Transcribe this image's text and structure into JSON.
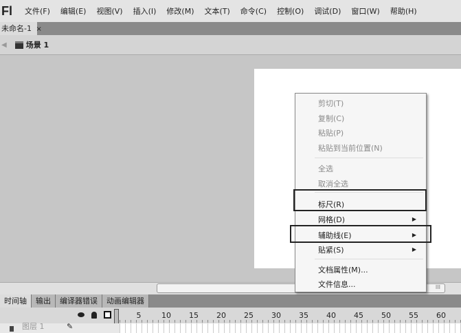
{
  "app": {
    "logo": "Fl"
  },
  "menubar": [
    "文件(F)",
    "编辑(E)",
    "视图(V)",
    "插入(I)",
    "修改(M)",
    "文本(T)",
    "命令(C)",
    "控制(O)",
    "调试(D)",
    "窗口(W)",
    "帮助(H)"
  ],
  "document_tab": {
    "title": "未命名-1",
    "close": "×"
  },
  "scene": {
    "label": "场景 1"
  },
  "context_menu": {
    "items": [
      {
        "label": "剪切(T)",
        "enabled": false
      },
      {
        "label": "复制(C)",
        "enabled": false
      },
      {
        "label": "粘贴(P)",
        "enabled": false
      },
      {
        "label": "粘贴到当前位置(N)",
        "enabled": false
      },
      {
        "label": "全选",
        "enabled": false
      },
      {
        "label": "取消全选",
        "enabled": false
      },
      {
        "label": "标尺(R)",
        "enabled": true,
        "highlighted": true
      },
      {
        "label": "网格(D)",
        "enabled": true,
        "submenu": true
      },
      {
        "label": "辅助线(E)",
        "enabled": true,
        "submenu": true,
        "highlighted": true
      },
      {
        "label": "贴紧(S)",
        "enabled": true,
        "submenu": true
      },
      {
        "label": "文档属性(M)...",
        "enabled": true
      },
      {
        "label": "文件信息...",
        "enabled": true
      }
    ]
  },
  "panel_tabs": [
    "时间轴",
    "输出",
    "编译器错误",
    "动画编辑器"
  ],
  "timeline": {
    "frame_numbers": [
      "5",
      "10",
      "15",
      "20",
      "25",
      "30",
      "35",
      "40",
      "45",
      "50",
      "55",
      "60"
    ],
    "layer_name": "图层 1"
  },
  "scrollbar": {
    "grip": "III"
  }
}
